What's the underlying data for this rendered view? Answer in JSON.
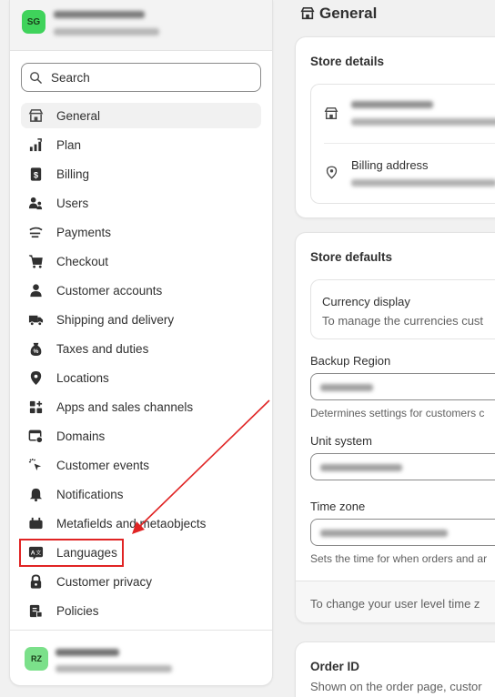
{
  "page": {
    "title": "General"
  },
  "store_switcher": {
    "avatar_initials": "SG"
  },
  "search": {
    "placeholder": "Search"
  },
  "nav": {
    "items": [
      {
        "label": "General",
        "icon": "store-icon",
        "active": true
      },
      {
        "label": "Plan",
        "icon": "plan-chart-icon"
      },
      {
        "label": "Billing",
        "icon": "billing-icon"
      },
      {
        "label": "Users",
        "icon": "users-icon"
      },
      {
        "label": "Payments",
        "icon": "payments-icon"
      },
      {
        "label": "Checkout",
        "icon": "cart-icon"
      },
      {
        "label": "Customer accounts",
        "icon": "person-icon"
      },
      {
        "label": "Shipping and delivery",
        "icon": "truck-icon"
      },
      {
        "label": "Taxes and duties",
        "icon": "tax-icon"
      },
      {
        "label": "Locations",
        "icon": "location-pin-icon"
      },
      {
        "label": "Apps and sales channels",
        "icon": "apps-icon"
      },
      {
        "label": "Domains",
        "icon": "domains-icon"
      },
      {
        "label": "Customer events",
        "icon": "cursor-click-icon"
      },
      {
        "label": "Notifications",
        "icon": "bell-icon"
      },
      {
        "label": "Metafields and metaobjects",
        "icon": "metafields-icon"
      },
      {
        "label": "Languages",
        "icon": "translate-icon"
      },
      {
        "label": "Customer privacy",
        "icon": "lock-icon"
      },
      {
        "label": "Policies",
        "icon": "policies-icon"
      }
    ]
  },
  "account": {
    "avatar_initials": "RZ"
  },
  "store_details": {
    "title": "Store details",
    "billing_address_label": "Billing address"
  },
  "store_defaults": {
    "title": "Store defaults",
    "currency_title": "Currency display",
    "currency_desc": "To manage the currencies cust",
    "backup_region_label": "Backup Region",
    "backup_region_help": "Determines settings for customers c",
    "unit_system_label": "Unit system",
    "time_zone_label": "Time zone",
    "time_zone_help": "Sets the time for when orders and ar",
    "footer_text": "To change your user level time z"
  },
  "order_id": {
    "title": "Order ID",
    "desc": "Shown on the order page, custor"
  },
  "colors": {
    "annotation": "#e02424",
    "store_avatar": "#3fd35b",
    "user_avatar": "#7be08a"
  }
}
